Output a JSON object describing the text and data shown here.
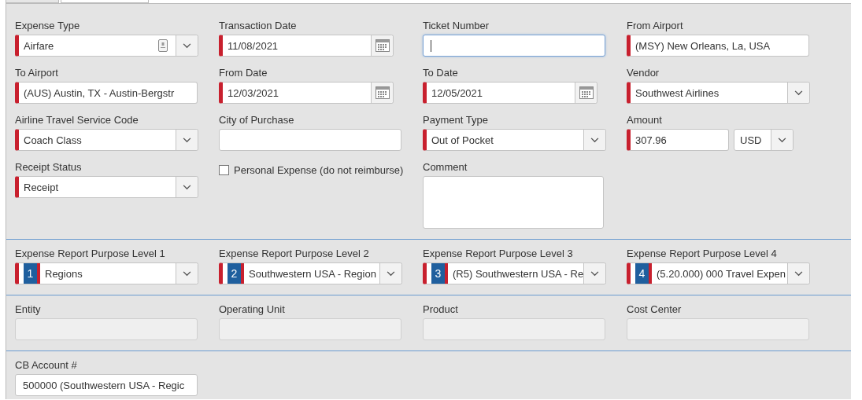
{
  "sections": [
    {
      "fields": [
        {
          "kind": "select",
          "label": "Expense Type",
          "value": "Airfare",
          "required": true,
          "attachment_icon": true
        },
        {
          "kind": "date",
          "label": "Transaction Date",
          "value": "11/08/2021",
          "required": true
        },
        {
          "kind": "text",
          "label": "Ticket Number",
          "required": false,
          "focused": true,
          "disabled": false
        },
        {
          "kind": "text",
          "label": "From Airport",
          "value": "(MSY) New Orleans, La, USA",
          "required": true,
          "focused": false,
          "disabled": false
        },
        {
          "kind": "text",
          "label": "To Airport",
          "value": "(AUS) Austin, TX - Austin-Bergstr",
          "required": true,
          "focused": false,
          "disabled": false
        },
        {
          "kind": "date",
          "label": "From Date",
          "value": "12/03/2021",
          "required": true
        },
        {
          "kind": "date",
          "label": "To Date",
          "value": "12/05/2021",
          "required": true
        },
        {
          "kind": "select",
          "label": "Vendor",
          "value": "Southwest Airlines",
          "required": true,
          "attachment_icon": false
        },
        {
          "kind": "select",
          "label": "Airline Travel Service Code",
          "value": "Coach Class",
          "required": true,
          "attachment_icon": false
        },
        {
          "kind": "text",
          "label": "City of Purchase",
          "required": false,
          "focused": false,
          "disabled": false
        },
        {
          "kind": "select",
          "label": "Payment Type",
          "value": "Out of Pocket",
          "required": true,
          "attachment_icon": false
        },
        {
          "kind": "amount",
          "label": "Amount",
          "value": "307.96",
          "currency": "USD",
          "required": true
        },
        {
          "kind": "select",
          "label": "Receipt Status",
          "value": "Receipt",
          "required": true,
          "attachment_icon": false
        },
        {
          "kind": "checkbox",
          "label": "Personal Expense (do not reimburse)",
          "checked": false
        },
        {
          "kind": "textarea",
          "label": "Comment"
        }
      ]
    },
    {
      "fields": [
        {
          "kind": "purpose",
          "label": "Expense Report Purpose Level 1",
          "number": "1",
          "value": "Regions",
          "required": true
        },
        {
          "kind": "purpose",
          "label": "Expense Report Purpose Level 2",
          "number": "2",
          "value": "Southwestern USA - Region",
          "required": true
        },
        {
          "kind": "purpose",
          "label": "Expense Report Purpose Level 3",
          "number": "3",
          "value": "(R5) Southwestern USA - Re",
          "required": true
        },
        {
          "kind": "purpose",
          "label": "Expense Report Purpose Level 4",
          "number": "4",
          "value": "(5.20.000) 000 Travel Expen",
          "required": true
        }
      ]
    },
    {
      "fields": [
        {
          "kind": "text",
          "label": "Entity",
          "required": false,
          "focused": false,
          "disabled": true
        },
        {
          "kind": "text",
          "label": "Operating Unit",
          "required": false,
          "focused": false,
          "disabled": true
        },
        {
          "kind": "text",
          "label": "Product",
          "required": false,
          "focused": false,
          "disabled": true
        },
        {
          "kind": "text",
          "label": "Cost Center",
          "required": false,
          "focused": false,
          "disabled": true
        }
      ]
    },
    {
      "fields": [
        {
          "kind": "text",
          "label": "CB Account #",
          "value": "500000 (Southwestern USA - Regic",
          "required": false,
          "focused": false,
          "disabled": false
        }
      ]
    }
  ]
}
